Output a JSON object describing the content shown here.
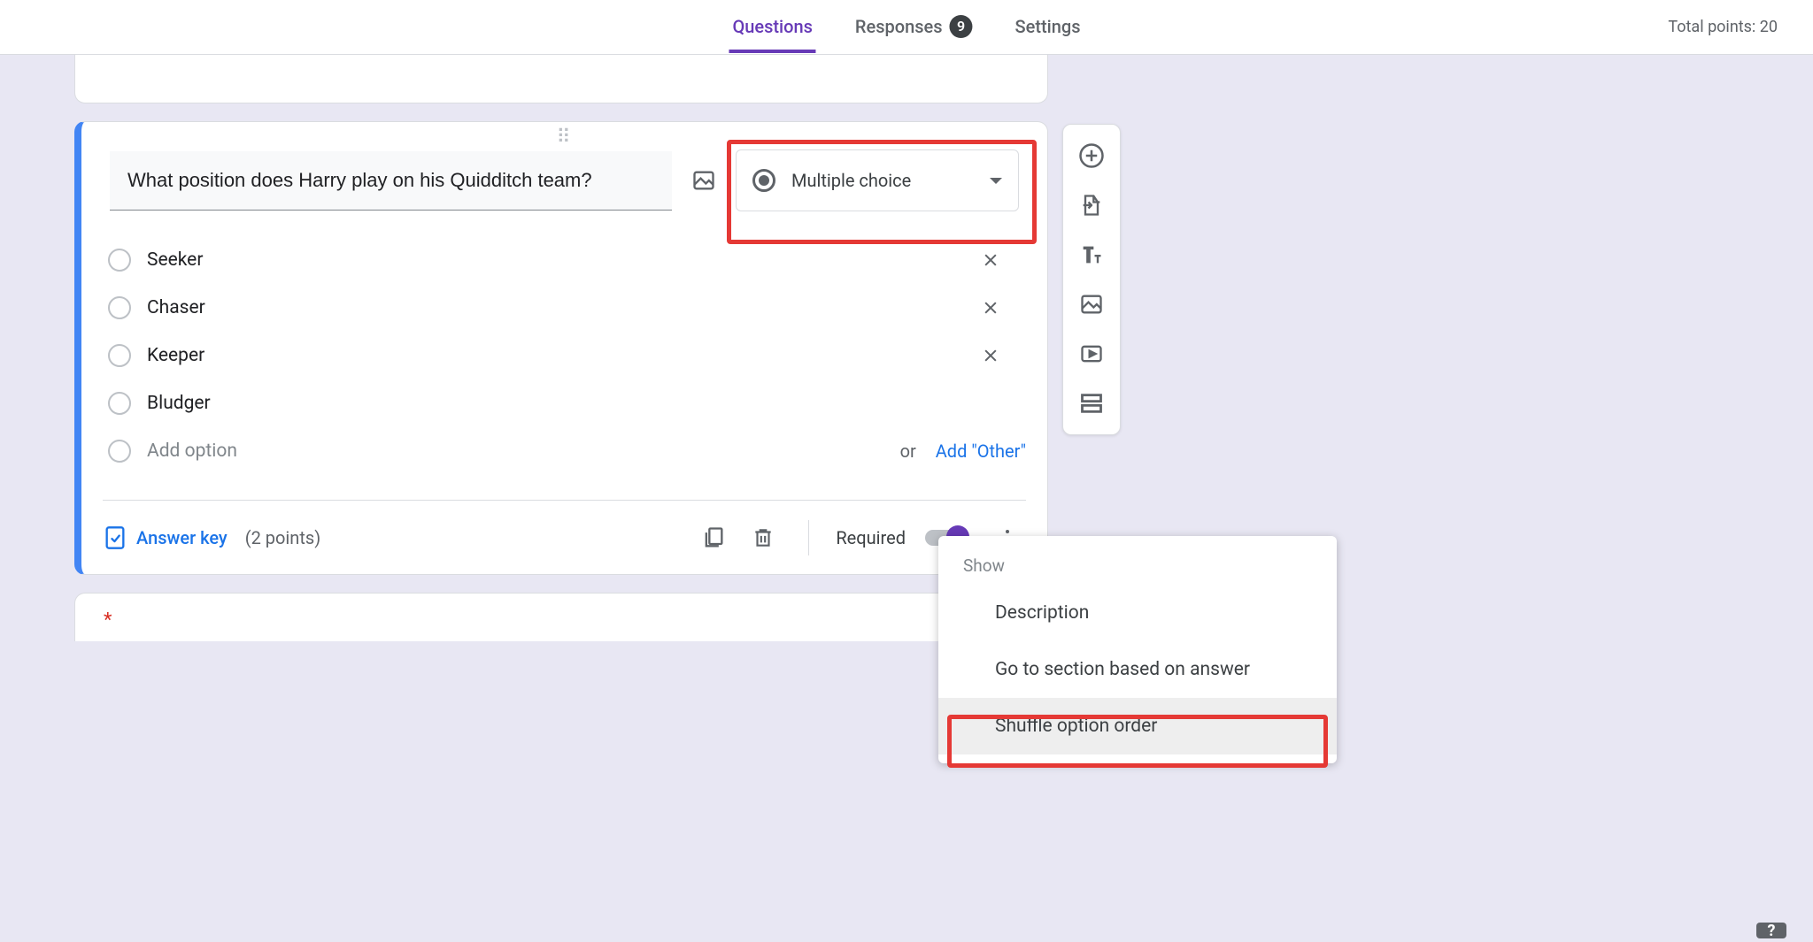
{
  "tabs": {
    "questions": "Questions",
    "responses": "Responses",
    "responses_count": "9",
    "settings": "Settings"
  },
  "totals": {
    "label": "Total points: 20"
  },
  "question": {
    "title": "What position does Harry play on his Quidditch team?",
    "type_label": "Multiple choice",
    "options": [
      "Seeker",
      "Chaser",
      "Keeper",
      "Bludger"
    ],
    "add_option": "Add option",
    "or": "or",
    "add_other": "Add \"Other\"",
    "answer_key": "Answer key",
    "points": "(2 points)",
    "required": "Required"
  },
  "menu": {
    "header": "Show",
    "description": "Description",
    "goto": "Go to section based on answer",
    "shuffle": "Shuffle option order"
  },
  "next_question_prefix": " ",
  "help": "?"
}
